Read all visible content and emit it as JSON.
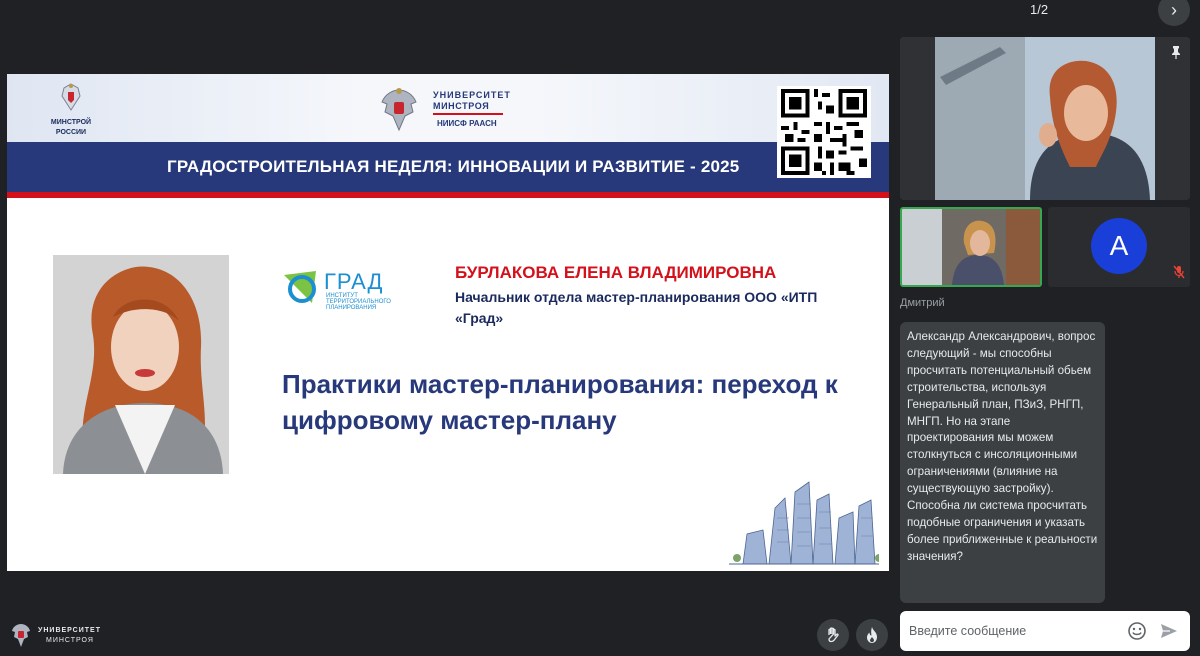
{
  "pager": {
    "counter": "1/2",
    "next_glyph": "›"
  },
  "slide": {
    "org_logo_left": {
      "line1": "МИНСТРОЙ",
      "line2": "РОССИИ"
    },
    "univ_logo": {
      "line1": "УНИВЕРСИТЕТ",
      "line2": "МИНСТРОЯ",
      "line3": "НИИСФ РААСН"
    },
    "band_title": "ГРАДОСТРОИТЕЛЬНАЯ НЕДЕЛЯ: ИННОВАЦИИ И РАЗВИТИЕ - 2025",
    "grad_logo": {
      "word": "ГРАД",
      "subtitle": "ИНСТИТУТ ТЕРРИТОРИАЛЬНОГО ПЛАНИРОВАНИЯ"
    },
    "speaker_name": "БУРЛАКОВА ЕЛЕНА ВЛАДИМИРОВНА",
    "speaker_role": "Начальник отдела мастер-планирования ООО «ИТП «Град»",
    "talk_title": "Практики мастер-планирования: переход к цифровому мастер-плану"
  },
  "participants": {
    "avatar_letter": "A"
  },
  "chat": {
    "sender": "Дмитрий",
    "message": "Александр Александрович, вопрос следующий - мы способны просчитать потенциальный обьем строительства, используя Генеральный план, ПЗиЗ, РНГП, МНГП. Но на этапе проектирования мы можем столкнуться с инсоляционными ограничениями (влияние на существующую застройку). Способна ли система просчитать подобные ограничения и указать более приближенные к реальности значения?",
    "input_placeholder": "Введите сообщение"
  },
  "footer": {
    "logo_line1": "УНИВЕРСИТЕТ",
    "logo_line2": "МИНСТРОЯ"
  },
  "colors": {
    "background": "#202124",
    "slide_band": "#27397a",
    "slide_accent_red": "#d4111b",
    "avatar": "#1a3fd8",
    "active_speaker_border": "#37a84f"
  }
}
